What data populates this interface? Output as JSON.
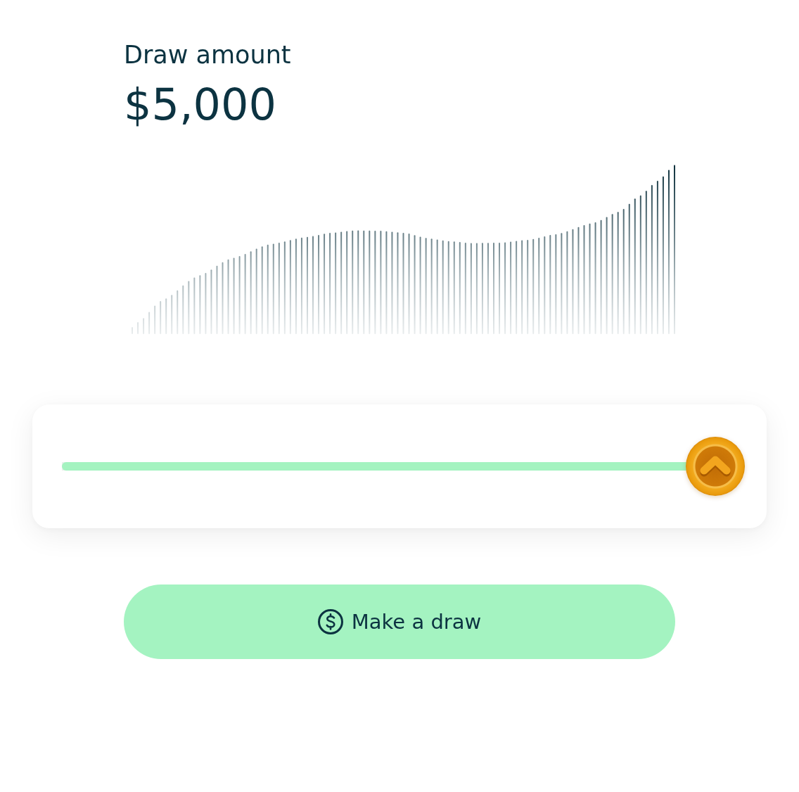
{
  "header": {
    "label": "Draw amount",
    "amount": "$5,000"
  },
  "slider": {
    "level": 1
  },
  "button": {
    "label": "Make a draw"
  }
}
